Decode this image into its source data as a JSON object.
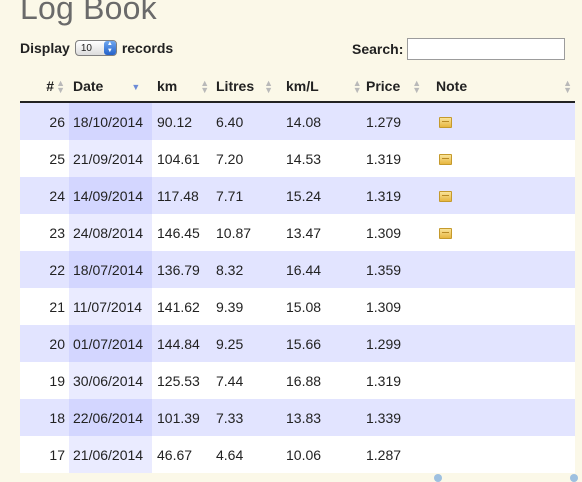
{
  "title": "Log Book",
  "controls": {
    "display_label": "Display",
    "records_label": "records",
    "page_size": "10",
    "search_label": "Search:",
    "search_value": ""
  },
  "table": {
    "columns": [
      {
        "key": "num",
        "label": "#"
      },
      {
        "key": "date",
        "label": "Date",
        "sorted": true
      },
      {
        "key": "km",
        "label": "km"
      },
      {
        "key": "litres",
        "label": "Litres"
      },
      {
        "key": "kml",
        "label": "km/L"
      },
      {
        "key": "price",
        "label": "Price"
      },
      {
        "key": "note",
        "label": "Note"
      }
    ],
    "rows": [
      {
        "num": "26",
        "date": "18/10/2014",
        "km": "90.12",
        "litres": "6.40",
        "kml": "14.08",
        "price": "1.279",
        "note_icon": "note-icon"
      },
      {
        "num": "25",
        "date": "21/09/2014",
        "km": "104.61",
        "litres": "7.20",
        "kml": "14.53",
        "price": "1.319",
        "note_icon": "note-icon"
      },
      {
        "num": "24",
        "date": "14/09/2014",
        "km": "117.48",
        "litres": "7.71",
        "kml": "15.24",
        "price": "1.319",
        "note_icon": "note-icon"
      },
      {
        "num": "23",
        "date": "24/08/2014",
        "km": "146.45",
        "litres": "10.87",
        "kml": "13.47",
        "price": "1.309",
        "note_icon": "note-icon"
      },
      {
        "num": "22",
        "date": "18/07/2014",
        "km": "136.79",
        "litres": "8.32",
        "kml": "16.44",
        "price": "1.359",
        "note_icon": ""
      },
      {
        "num": "21",
        "date": "11/07/2014",
        "km": "141.62",
        "litres": "9.39",
        "kml": "15.08",
        "price": "1.309",
        "note_icon": ""
      },
      {
        "num": "20",
        "date": "01/07/2014",
        "km": "144.84",
        "litres": "9.25",
        "kml": "15.66",
        "price": "1.299",
        "note_icon": ""
      },
      {
        "num": "19",
        "date": "30/06/2014",
        "km": "125.53",
        "litres": "7.44",
        "kml": "16.88",
        "price": "1.319",
        "note_icon": ""
      },
      {
        "num": "18",
        "date": "22/06/2014",
        "km": "101.39",
        "litres": "7.33",
        "kml": "13.83",
        "price": "1.339",
        "note_icon": ""
      },
      {
        "num": "17",
        "date": "21/06/2014",
        "km": "46.67",
        "litres": "4.64",
        "kml": "10.06",
        "price": "1.287",
        "note_icon": ""
      }
    ]
  },
  "colors": {
    "page_bg": "#fbf8e8",
    "row_odd": "#e2e4ff",
    "row_even": "#ffffff",
    "sorted_col_odd": "#d3d6ff",
    "sorted_col_even": "#eaebff",
    "title": "#6a6a6a"
  }
}
